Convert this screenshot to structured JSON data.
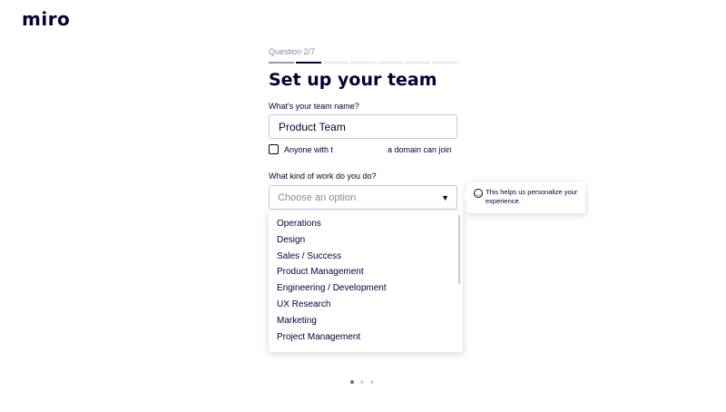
{
  "brand": {
    "logo_text": "miro"
  },
  "onboarding": {
    "question_label": "Question 2/7",
    "progress": {
      "current": 2,
      "total": 7
    },
    "title": "Set up your team",
    "team_name": {
      "label": "What's your team name?",
      "value": "Product Team"
    },
    "domain_join": {
      "label_prefix": "Anyone with t",
      "label_suffix": "a domain can join",
      "checked": false
    },
    "work_kind": {
      "label": "What kind of work do you do?",
      "placeholder": "Choose an option",
      "options": [
        "Operations",
        "Design",
        "Sales / Success",
        "Product Management",
        "Engineering / Development",
        "UX Research",
        "Marketing",
        "Project Management"
      ]
    },
    "tooltip": {
      "icon": "smile-icon",
      "text": "This helps us personalize your experience."
    },
    "pagination": {
      "current": 1,
      "total": 3
    }
  },
  "colors": {
    "brand_navy": "#050038",
    "muted_text": "#8a8a9e",
    "border": "#c7c7d1"
  }
}
